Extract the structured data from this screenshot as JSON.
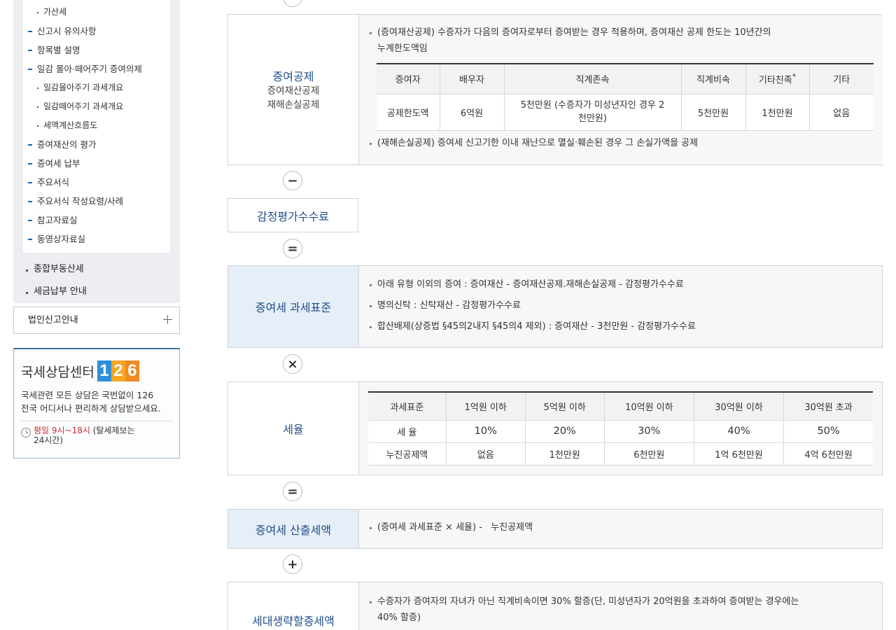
{
  "sidebar": {
    "sub_items": [
      {
        "level": 4,
        "label": "가산세"
      },
      {
        "level": 3,
        "label": "신고시 유의사항"
      },
      {
        "level": 3,
        "label": "항목별 설명"
      },
      {
        "level": 3,
        "label": "일감 몰아·떼어주기 증여의제"
      },
      {
        "level": 4,
        "label": "일감몰아주기 과세개요"
      },
      {
        "level": 4,
        "label": "일감떼어주기 과세개요"
      },
      {
        "level": 4,
        "label": "세액계산흐름도"
      },
      {
        "level": 3,
        "label": "증여재산의 평가"
      },
      {
        "level": 3,
        "label": "증여세 납부"
      },
      {
        "level": 3,
        "label": "주요서식"
      },
      {
        "level": 3,
        "label": "주요서식 작성요령/사례"
      },
      {
        "level": 3,
        "label": "참고자료실"
      },
      {
        "level": 3,
        "label": "동영상자료실"
      }
    ],
    "level2_items": [
      "종합부동산세",
      "세금납부 안내"
    ],
    "level1_item": "법인신고안내",
    "callcenter": {
      "title": "국세상담센터",
      "logo_digits": [
        "1",
        "2",
        "6"
      ],
      "desc_line1": "국세관련 모든 상담은 국번없이 126",
      "desc_line2": "전국 어디서나 편리하게 상담받으세요.",
      "hours_red": "평일 9시~18시",
      "hours_rest": " (탈세제보는",
      "hours_line2": "24시간)"
    }
  },
  "main": {
    "deduction": {
      "title": "증여공제",
      "sub1": "증여재산공제",
      "sub2": "재해손실공제",
      "bullet1": "(증여재산공제) 수증자가 다음의 증여자로부터 증여받는 경우 적용하며, 증여재산 공제 한도는 10년간의",
      "bullet1_cont": "누계한도액임",
      "table": {
        "headers": [
          "증여자",
          "배우자",
          "직계존속",
          "직계비속",
          "기타친족",
          "기타"
        ],
        "header_star": "*",
        "row_label": "공제한도액",
        "row_values": [
          "6억원",
          "5천만원 (수증자가 미성년자인 경우 2",
          "5천만원",
          "1천만원",
          "없음"
        ],
        "row_value2_cont": "천만원)"
      },
      "bullet2": "(재해손실공제) 증여세 신고기한 이내 재난으로 멸실·훼손된 경우 그 손실가액을 공제"
    },
    "ops": {
      "minus": "−",
      "equals1": "=",
      "times": "×",
      "equals2": "=",
      "plus": "+"
    },
    "appraisal_fee": "감정평가수수료",
    "tax_base": {
      "title": "증여세 과세표준",
      "bullets": [
        "아래 유형 이외의 증여 : 증여재산 - 증여재산공제.재해손실공제 - 감정평가수수료",
        "명의신탁 : 신탁재산 - 감정평가수수료",
        "합산배제(상증법 §45의2내지 §45의4 제외) : 증여재산 - 3천만원 - 감정평가수수료"
      ]
    },
    "tax_rate": {
      "title": "세율",
      "headers": [
        "과세표준",
        "1억원 이하",
        "5억원 이하",
        "10억원 이하",
        "30억원 이하",
        "30억원 초과"
      ],
      "rate_label": "세 율",
      "rates": [
        "10%",
        "20%",
        "30%",
        "40%",
        "50%"
      ],
      "deduction_label": "누진공제액",
      "deductions": [
        "없음",
        "1천만원",
        "6천만원",
        "1억 6천만원",
        "4억 6천만원"
      ]
    },
    "computed_tax": {
      "title": "증여세 산출세액",
      "bullet": "(증여세 과세표준 × 세율) -   누진공제액"
    },
    "generation_skip": {
      "title": "세대생략할증세액",
      "bullet": "수증자가 증여자의 자녀가 아닌 직계비속이면 30% 할증(단, 미성년자가 20억원을 초과하여 증여받는 경우에는",
      "bullet_cont": "40% 할증)"
    }
  }
}
